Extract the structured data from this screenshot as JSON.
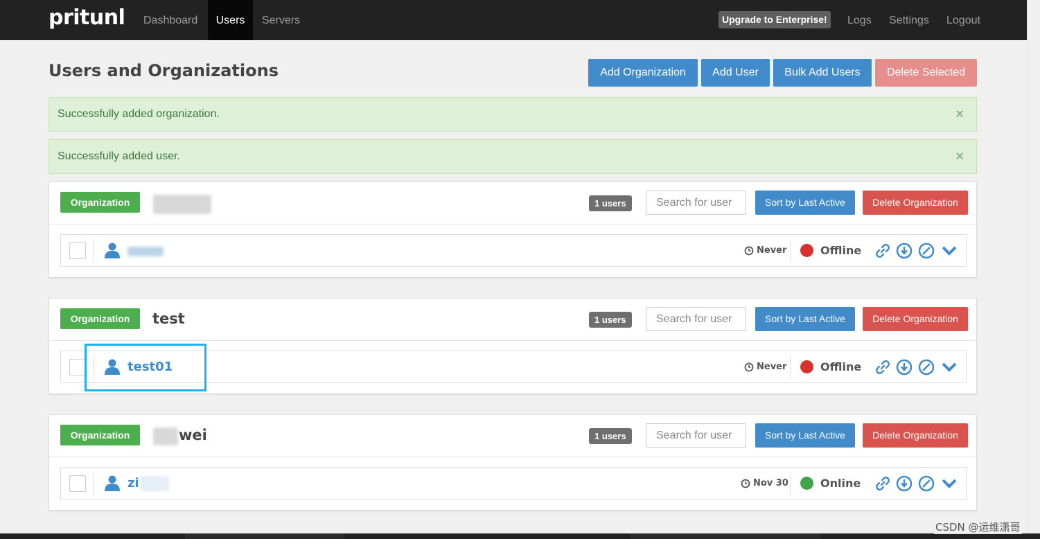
{
  "nav": {
    "brand": "pritunl",
    "links": [
      "Dashboard",
      "Users",
      "Servers"
    ],
    "active": "Users",
    "upgrade": "Upgrade to Enterprise!",
    "right_links": [
      "Logs",
      "Settings",
      "Logout"
    ]
  },
  "page": {
    "title": "Users and Organizations",
    "buttons": {
      "add_org": "Add Organization",
      "add_user": "Add User",
      "bulk_add": "Bulk Add Users",
      "delete_selected": "Delete Selected"
    }
  },
  "alerts": [
    {
      "text": "Successfully added organization.",
      "close": "×"
    },
    {
      "text": "Successfully added user.",
      "close": "×"
    }
  ],
  "organizations": [
    {
      "label": "Organization",
      "name": "",
      "users_badge": "1 users",
      "search_placeholder": "Search for user",
      "sort_label": "Sort by Last Active",
      "delete_label": "Delete Organization",
      "user": {
        "name": "",
        "last_active": "Never",
        "status": "Offline"
      }
    },
    {
      "label": "Organization",
      "name": "test",
      "users_badge": "1 users",
      "search_placeholder": "Search for user",
      "sort_label": "Sort by Last Active",
      "delete_label": "Delete Organization",
      "user": {
        "name": "test01",
        "last_active": "Never",
        "status": "Offline"
      }
    },
    {
      "label": "Organization",
      "name": "wei",
      "users_badge": "1 users",
      "search_placeholder": "Search for user",
      "sort_label": "Sort by Last Active",
      "delete_label": "Delete Organization",
      "user": {
        "name": "zi",
        "last_active": "Nov 30",
        "status": "Online"
      }
    }
  ],
  "colors": {
    "navbar": "#222222",
    "primary": "#428bca",
    "danger": "#d9534f",
    "success": "#4cae4c",
    "offline": "#d9312c",
    "online": "#3fa548",
    "highlight": "#1ab2f0"
  },
  "icons": [
    "user-icon",
    "clock-icon",
    "link-icon",
    "download-icon",
    "disable-icon",
    "chevron-down-icon"
  ],
  "watermark": "CSDN @运维潇哥"
}
